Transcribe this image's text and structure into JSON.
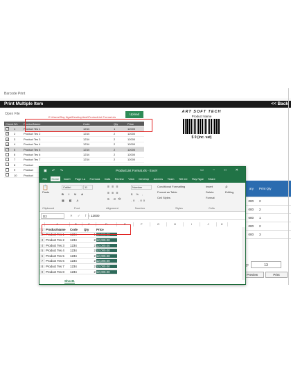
{
  "app": {
    "window_title": "Barcode Print",
    "header": "Print Multiple Item",
    "back_label": "<< Back",
    "open_file": "Open File",
    "path": "E:\\Users\\Ray Ngai\\Desktop\\test\\ProductList Format.xls",
    "upload_label": "Upload",
    "grid_headers": [
      "Check",
      "S/L",
      "ProductName",
      "Code",
      "Qty",
      "Price"
    ],
    "grid_rows": [
      {
        "checked": true,
        "sl": "1",
        "name": "Product Tes 1",
        "code": "1234",
        "qty": "1",
        "price": "12000"
      },
      {
        "checked": true,
        "sl": "2",
        "name": "Product Tes 2",
        "code": "1234",
        "qty": "2",
        "price": "12000"
      },
      {
        "checked": true,
        "sl": "3",
        "name": "Product Tes 3",
        "code": "1234",
        "qty": "2",
        "price": "12000"
      },
      {
        "checked": true,
        "sl": "4",
        "name": "Product Tes 4",
        "code": "1234",
        "qty": "2",
        "price": "12000"
      },
      {
        "checked": true,
        "sl": "5",
        "name": "Product Tes 5",
        "code": "1234",
        "qty": "2",
        "price": "12000"
      },
      {
        "checked": false,
        "sl": "6",
        "name": "Product Tes 6",
        "code": "1234",
        "qty": "2",
        "price": "12000"
      },
      {
        "checked": false,
        "sl": "7",
        "name": "Product Tes 7",
        "code": "1234",
        "qty": "2",
        "price": "12000"
      },
      {
        "checked": false,
        "sl": "8",
        "name": "Product",
        "code": "",
        "qty": "",
        "price": ""
      },
      {
        "checked": false,
        "sl": "9",
        "name": "Product",
        "code": "",
        "qty": "",
        "price": ""
      },
      {
        "checked": false,
        "sl": "10",
        "name": "Product",
        "code": "",
        "qty": "",
        "price": ""
      }
    ],
    "label_logo": "ART SOFT TECH",
    "label_product": "Product Name",
    "label_price": "$ 0 (inc. vat)",
    "print_table": {
      "headers": [
        "ary",
        "Print Qty"
      ],
      "rows": [
        {
          "a": "000",
          "b": "2"
        },
        {
          "a": "000",
          "b": "2"
        },
        {
          "a": "000",
          "b": "1"
        },
        {
          "a": "000",
          "b": "2"
        },
        {
          "a": "000",
          "b": "3"
        }
      ]
    },
    "qty_label": "Qty:",
    "qty_value": "13",
    "preview_label": "Preview",
    "print_label": "Print"
  },
  "excel": {
    "title": "ProductList Format.xls - Excel",
    "tabs": [
      "File",
      "Home",
      "Insert",
      "Page La",
      "Formula",
      "Data",
      "Review",
      "View",
      "Develop",
      "Add-ins",
      "Team",
      "Tell me",
      "Ray Ngai",
      "Share"
    ],
    "active_tab": "Home",
    "ribbon": {
      "paste": "Paste",
      "font_name": "Calibri",
      "font_size": "11",
      "number_format": "Number",
      "cond_format": "Conditional Formatting",
      "format_table": "Format as Table",
      "cell_styles": "Cell Styles",
      "insert": "Insert",
      "delete": "Delete",
      "format": "Format",
      "editing": "Editing",
      "groups": [
        "Clipboard",
        "Font",
        "Alignment",
        "Number",
        "Styles",
        "Cells"
      ]
    },
    "name_box": "D2",
    "formula_value": "12000",
    "columns": [
      "A",
      "B",
      "C",
      "D",
      "E",
      "F",
      "G",
      "H",
      "I",
      "J",
      "K"
    ],
    "headers": [
      "ProductName",
      "Code",
      "Qty",
      "Price"
    ],
    "rows": [
      {
        "name": "Product Tes 1",
        "code": "1234",
        "qty": "1",
        "price": "12,000.00"
      },
      {
        "name": "Product Tes 2",
        "code": "1234",
        "qty": "2",
        "price": "12,000.00"
      },
      {
        "name": "Product Tes 3",
        "code": "1234",
        "qty": "2",
        "price": "12,000.00"
      },
      {
        "name": "Product Tes 4",
        "code": "1234",
        "qty": "2",
        "price": "12,000.00"
      },
      {
        "name": "Product Tes 5",
        "code": "1234",
        "qty": "2",
        "price": "12,000.00"
      },
      {
        "name": "Product Tes 6",
        "code": "1234",
        "qty": "2",
        "price": "12,000.00"
      },
      {
        "name": "Product Tes 7",
        "code": "1234",
        "qty": "2",
        "price": "12,000.00"
      },
      {
        "name": "Product Tes 8",
        "code": "1234",
        "qty": "2",
        "price": "12,000.00"
      }
    ],
    "sheet_tab": "Sheet1"
  }
}
